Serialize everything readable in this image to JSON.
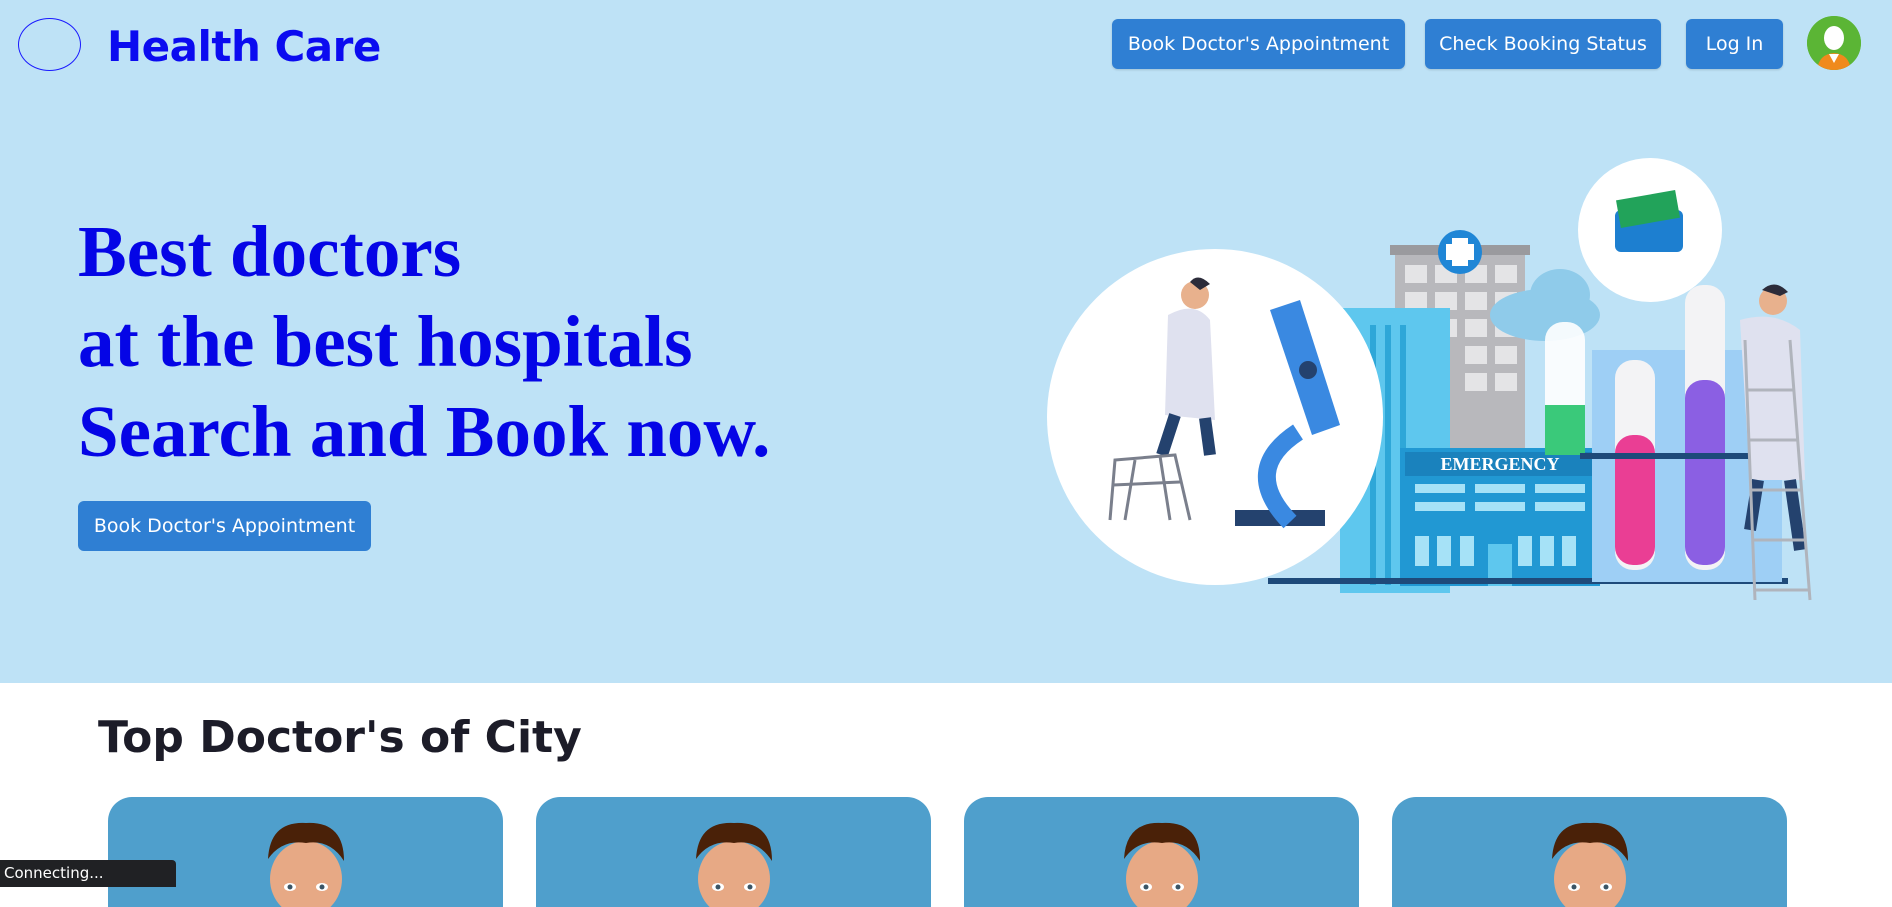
{
  "header": {
    "brand": "Health Care",
    "nav": {
      "book_label": "Book Doctor's Appointment",
      "status_label": "Check Booking Status",
      "login_label": "Log In"
    }
  },
  "hero": {
    "line1": "Best doctors",
    "line2": "at the best hospitals",
    "line3": "Search and Book now.",
    "cta_label": "Book Doctor's Appointment",
    "illustration_sign": "EMERGENCY"
  },
  "section": {
    "title": "Top Doctor's of City",
    "cards": [
      {
        "icon": "doctor-avatar-icon"
      },
      {
        "icon": "doctor-avatar-icon"
      },
      {
        "icon": "doctor-avatar-icon"
      },
      {
        "icon": "doctor-avatar-icon"
      }
    ]
  },
  "status": {
    "text": "Connecting..."
  },
  "colors": {
    "hero_bg": "#bee2f6",
    "brand": "#0b0bf0",
    "button": "#2f7fd3",
    "card": "#4f9fcc"
  }
}
